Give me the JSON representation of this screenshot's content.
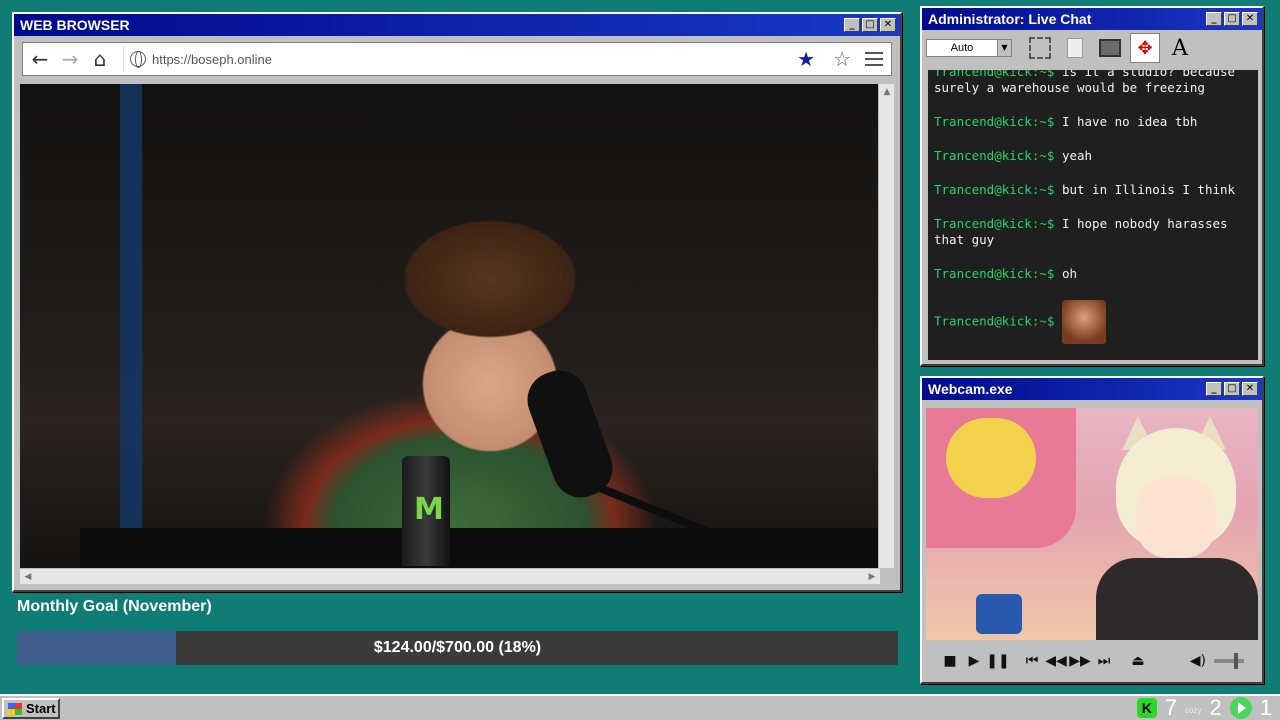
{
  "browser": {
    "title": "WEB BROWSER",
    "url": "https://boseph.online"
  },
  "goal": {
    "title": "Monthly Goal (November)",
    "progress_text": "$124.00/$700.00 (18%)",
    "progress_fraction": 0.18,
    "fill_color": "#3f5f8c"
  },
  "chat": {
    "title": "Administrator: Live Chat",
    "zoom_select": "Auto",
    "text_tool": "A",
    "messages": [
      {
        "user": "Trancend@kick:~$",
        "text": "is it a studio? because surely a warehouse would be freezing"
      },
      {
        "user": "Trancend@kick:~$",
        "text": "I have no idea tbh"
      },
      {
        "user": "Trancend@kick:~$",
        "text": "yeah"
      },
      {
        "user": "Trancend@kick:~$",
        "text": "but in Illinois I think"
      },
      {
        "user": "Trancend@kick:~$",
        "text": "I hope nobody harasses that guy"
      },
      {
        "user": "Trancend@kick:~$",
        "text": "oh"
      },
      {
        "user": "Trancend@kick:~$",
        "text": ""
      }
    ]
  },
  "webcam": {
    "title": "Webcam.exe"
  },
  "taskbar": {
    "start_label": "Start",
    "tray": {
      "kick_count": "7",
      "cozy_label": "cozy",
      "cozy_count": "2",
      "play_count": "1"
    }
  },
  "colors": {
    "desktop": "#0f7d76",
    "titlebar": "#000a8c",
    "chat_user": "#27d36b"
  }
}
